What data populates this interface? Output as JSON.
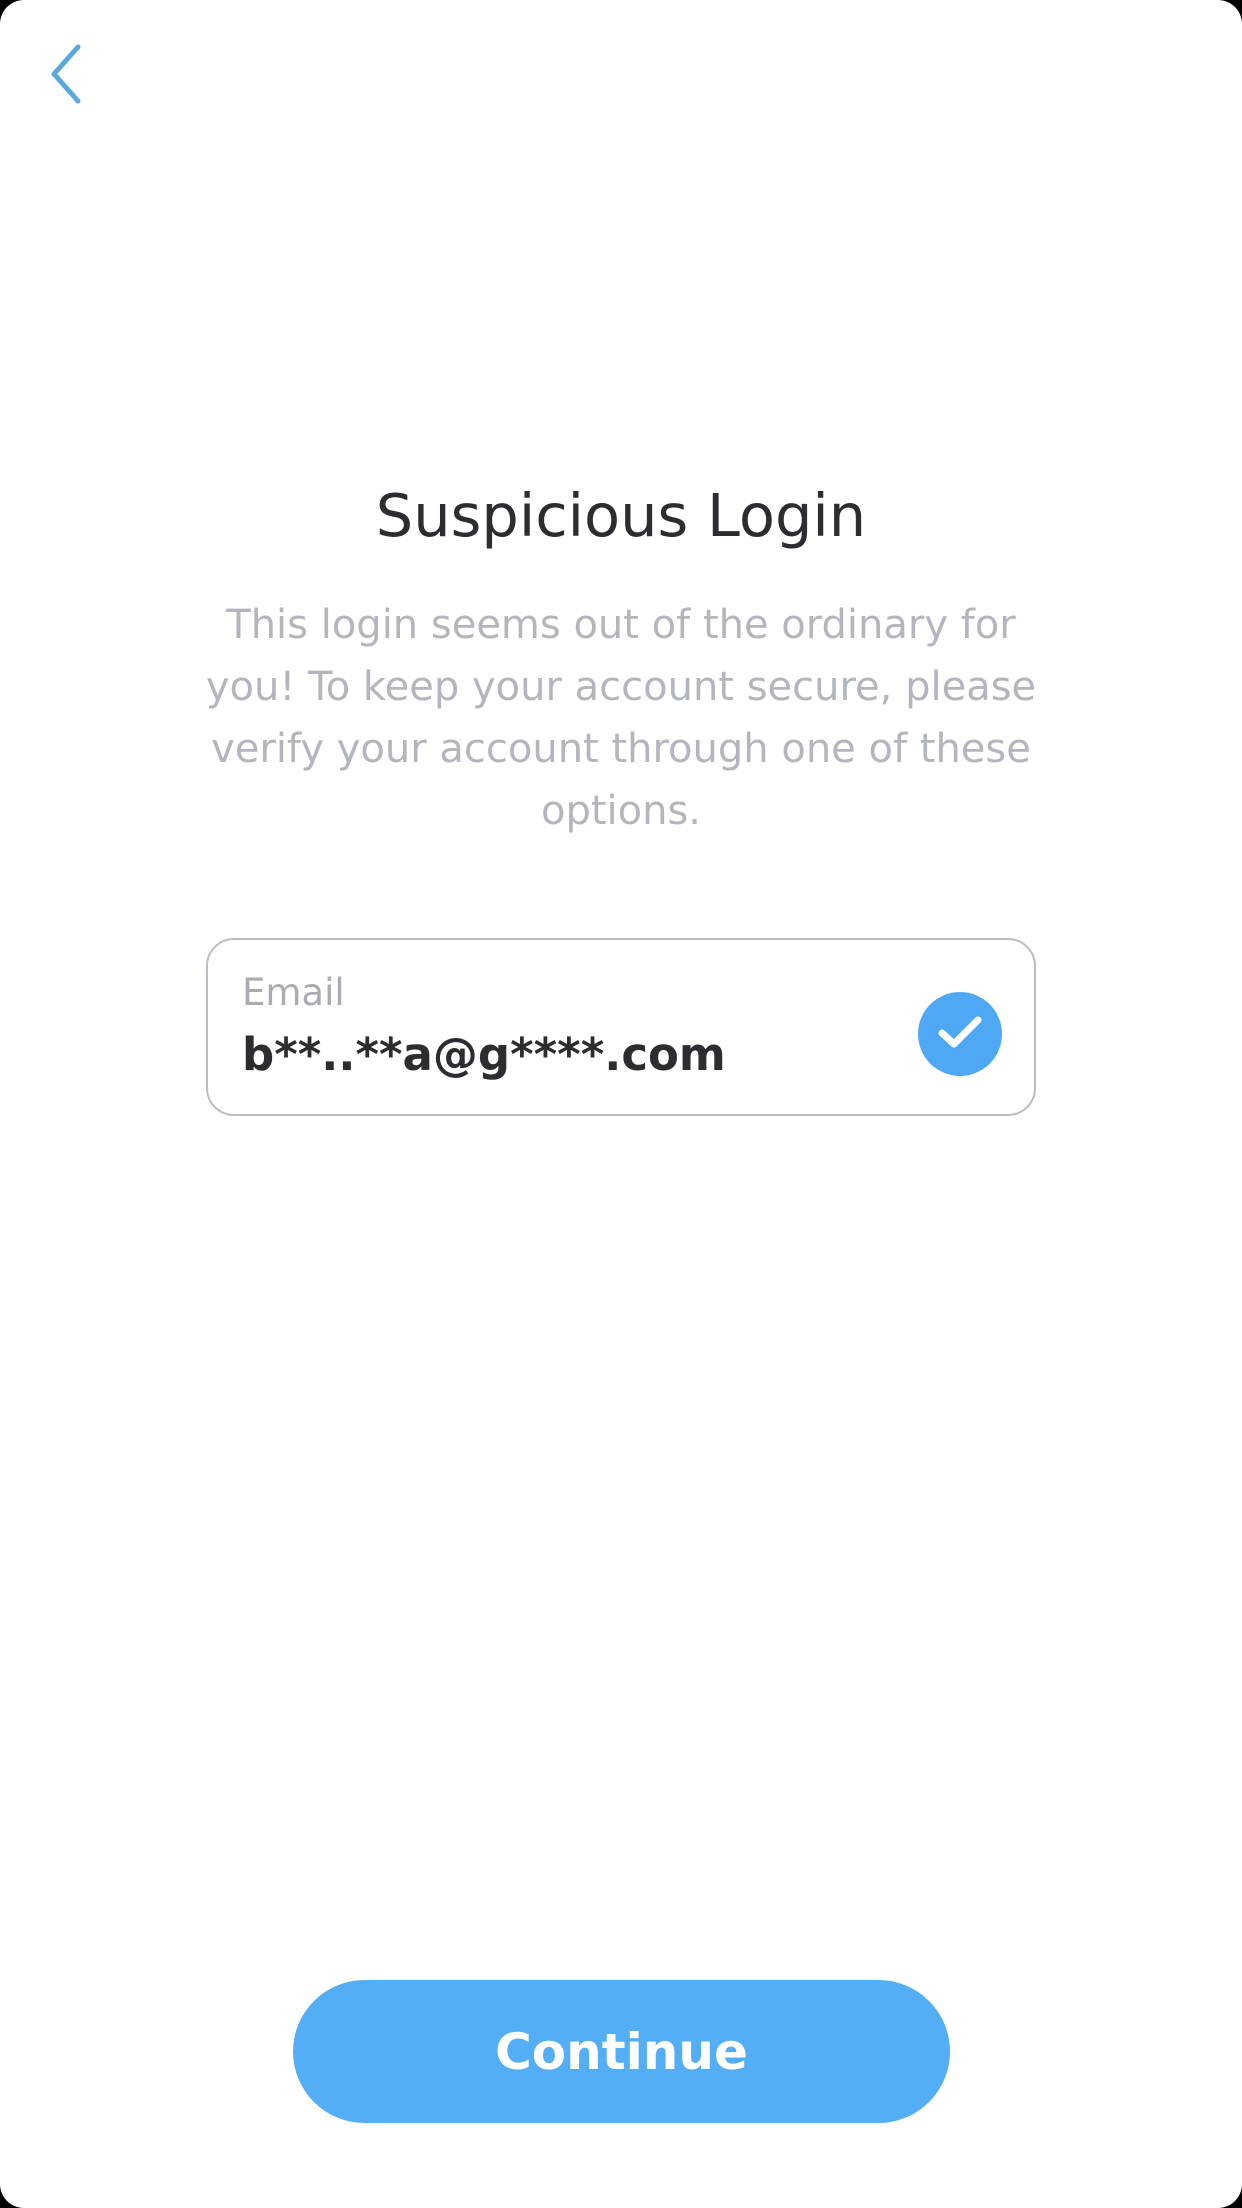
{
  "header": {
    "back_icon": "chevron-left-icon",
    "accent_color": "#5aa8dc"
  },
  "main": {
    "title": "Suspicious Login",
    "description": "This login seems out of the ordinary for you! To keep your account secure, please verify your account through one of these options."
  },
  "verification_option": {
    "label": "Email",
    "value": "b**..**a@g****.com",
    "selected": true,
    "selected_icon": "checkmark-icon",
    "selected_color": "#4ea8f3"
  },
  "footer": {
    "continue_label": "Continue",
    "button_color": "#53aef6"
  }
}
